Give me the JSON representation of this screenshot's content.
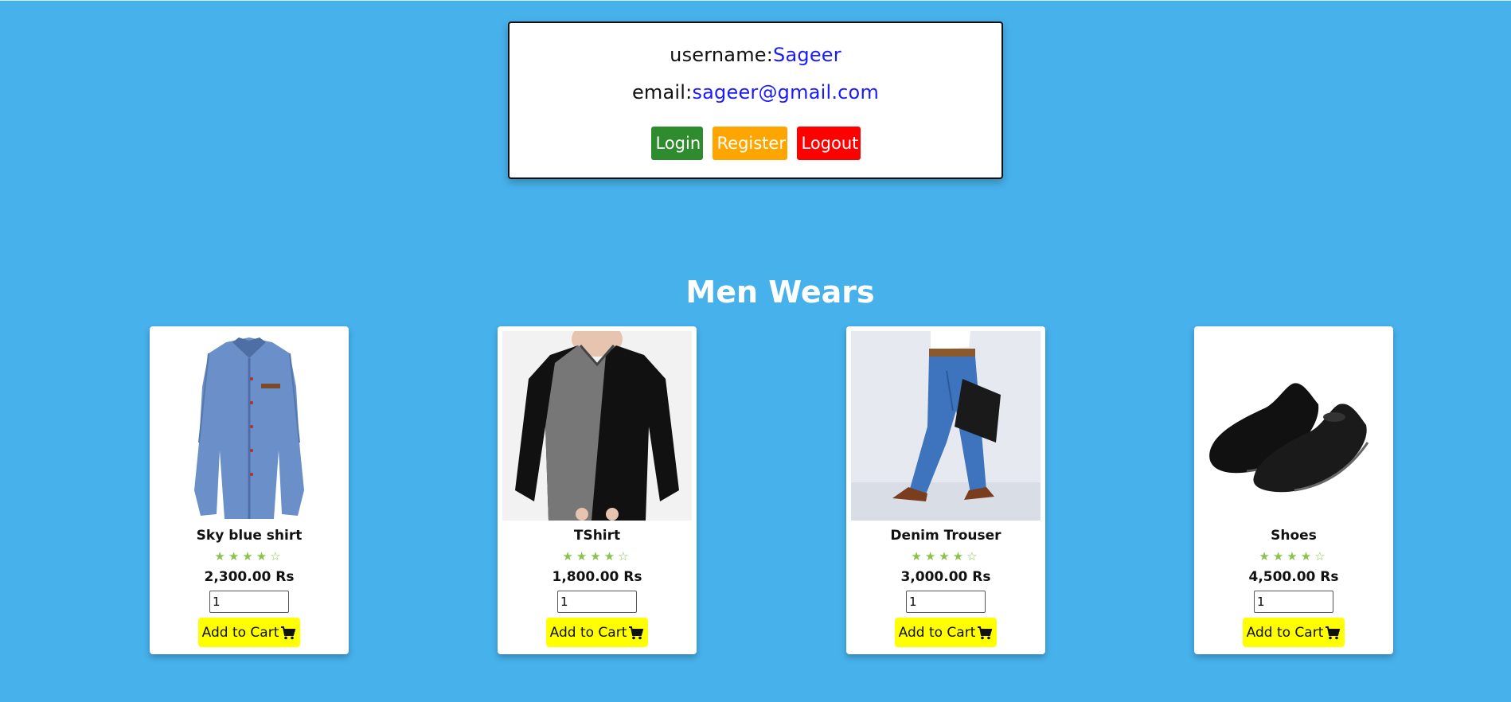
{
  "user": {
    "username_label": "username:",
    "username_value": "Sageer",
    "email_label": "email:",
    "email_value": "sageer@gmail.com"
  },
  "buttons": {
    "login": {
      "label": "Login",
      "color": "#2e8b2e"
    },
    "register": {
      "label": "Register",
      "color": "#ffa500"
    },
    "logout": {
      "label": "Logout",
      "color": "#ff0000"
    }
  },
  "section": {
    "title": "Men Wears"
  },
  "products": [
    {
      "name": "Sky blue shirt",
      "rating": 4,
      "rating_max": 5,
      "price": "2,300.00 Rs",
      "quantity": "1",
      "cart_label": "Add to Cart",
      "image_icon": "shirt-image"
    },
    {
      "name": "TShirt",
      "rating": 4,
      "rating_max": 5,
      "price": "1,800.00 Rs",
      "quantity": "1",
      "cart_label": "Add to Cart",
      "image_icon": "tshirt-image"
    },
    {
      "name": "Denim Trouser",
      "rating": 4,
      "rating_max": 5,
      "price": "3,000.00 Rs",
      "quantity": "1",
      "cart_label": "Add to Cart",
      "image_icon": "trouser-image"
    },
    {
      "name": "Shoes",
      "rating": 4,
      "rating_max": 5,
      "price": "4,500.00 Rs",
      "quantity": "1",
      "cart_label": "Add to Cart",
      "image_icon": "shoes-image"
    }
  ],
  "colors": {
    "background": "#47b1eb",
    "link": "#1a1aff",
    "star": "#8bc34a",
    "cart_button": "#ffff00"
  }
}
